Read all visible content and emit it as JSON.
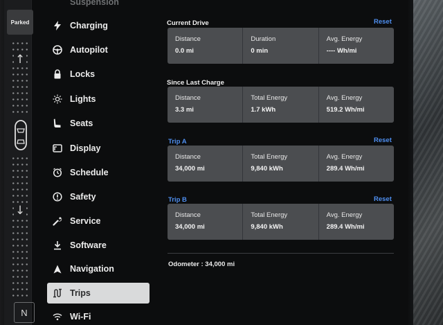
{
  "status": {
    "gear_badge": "Parked",
    "gear_neutral": "N"
  },
  "sidebar": {
    "items": [
      {
        "label": "Suspension",
        "icon": "suspension-icon"
      },
      {
        "label": "Charging",
        "icon": "lightning-icon"
      },
      {
        "label": "Autopilot",
        "icon": "steering-wheel-icon"
      },
      {
        "label": "Locks",
        "icon": "lock-icon"
      },
      {
        "label": "Lights",
        "icon": "sun-icon"
      },
      {
        "label": "Seats",
        "icon": "seat-icon"
      },
      {
        "label": "Display",
        "icon": "display-icon"
      },
      {
        "label": "Schedule",
        "icon": "clock-icon"
      },
      {
        "label": "Safety",
        "icon": "alert-circle-icon"
      },
      {
        "label": "Service",
        "icon": "wrench-icon"
      },
      {
        "label": "Software",
        "icon": "download-icon"
      },
      {
        "label": "Navigation",
        "icon": "navigation-arrow-icon"
      },
      {
        "label": "Trips",
        "icon": "trips-icon"
      },
      {
        "label": "Wi-Fi",
        "icon": "wifi-icon"
      }
    ],
    "active": "Trips"
  },
  "trips": {
    "current_drive": {
      "title": "Current Drive",
      "reset": "Reset",
      "cols": [
        {
          "label": "Distance",
          "value": "0.0 mi"
        },
        {
          "label": "Duration",
          "value": "0 min"
        },
        {
          "label": "Avg. Energy",
          "value": "---- Wh/mi"
        }
      ]
    },
    "since_last_charge": {
      "title": "Since Last Charge",
      "cols": [
        {
          "label": "Distance",
          "value": "3.3 mi"
        },
        {
          "label": "Total Energy",
          "value": "1.7 kWh"
        },
        {
          "label": "Avg. Energy",
          "value": "519.2 Wh/mi"
        }
      ]
    },
    "trip_a": {
      "title": "Trip A",
      "reset": "Reset",
      "cols": [
        {
          "label": "Distance",
          "value": "34,000 mi"
        },
        {
          "label": "Total Energy",
          "value": "9,840 kWh"
        },
        {
          "label": "Avg. Energy",
          "value": "289.4 Wh/mi"
        }
      ]
    },
    "trip_b": {
      "title": "Trip B",
      "reset": "Reset",
      "cols": [
        {
          "label": "Distance",
          "value": "34,000 mi"
        },
        {
          "label": "Total Energy",
          "value": "9,840 kWh"
        },
        {
          "label": "Avg. Energy",
          "value": "289.4 Wh/mi"
        }
      ]
    },
    "odometer": "Odometer : 34,000 mi"
  },
  "colors": {
    "accent": "#4f8ff0",
    "card": "#4b4d50",
    "active_item": "#d9dadb",
    "background": "#0c0d0e"
  }
}
